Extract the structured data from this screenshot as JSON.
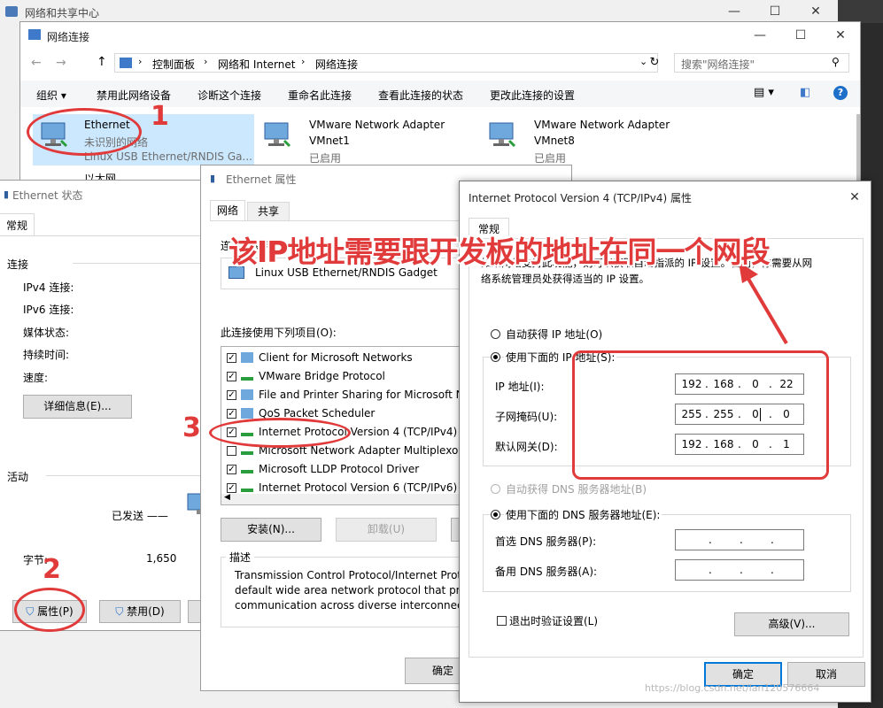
{
  "bg_window": {
    "title": "网络和共享中心"
  },
  "net_window": {
    "title": "网络连接",
    "breadcrumb": [
      "控制面板",
      "网络和 Internet",
      "网络连接"
    ],
    "search_placeholder": "搜索\"网络连接\"",
    "toolbar": [
      "组织 ▾",
      "禁用此网络设备",
      "诊断这个连接",
      "重命名此连接",
      "查看此连接的状态",
      "更改此连接的设置"
    ],
    "adapters": [
      {
        "name": "Ethernet",
        "status": "未识别的网络",
        "device": "Linux USB Ethernet/RNDIS Ga..."
      },
      {
        "name": "VMware Network Adapter",
        "status": "VMnet1",
        "device": "已启用"
      },
      {
        "name": "VMware Network Adapter",
        "status": "VMnet8",
        "device": "已启用"
      },
      {
        "name": "以太网",
        "status": "",
        "device": ""
      }
    ]
  },
  "status_window": {
    "title": "Ethernet 状态",
    "tab": "常规",
    "connection_header": "连接",
    "rows": [
      "IPv4 连接:",
      "IPv6 连接:",
      "媒体状态:",
      "持续时间:",
      "速度:"
    ],
    "details_button": "详细信息(E)...",
    "activity_header": "活动",
    "sent_label": "已发送 ——",
    "bytes_label": "字节:",
    "bytes_value": "1,650",
    "properties_button": "属性(P)",
    "disable_button": "禁用(D)"
  },
  "props_window": {
    "title": "Ethernet 属性",
    "tabs": [
      "网络",
      "共享"
    ],
    "connect_using_label": "连接时使用:",
    "adapter": "Linux USB Ethernet/RNDIS Gadget",
    "items_label": "此连接使用下列项目(O):",
    "items": [
      {
        "label": "Client for Microsoft Networks",
        "checked": true
      },
      {
        "label": "VMware Bridge Protocol",
        "checked": true
      },
      {
        "label": "File and Printer Sharing for Microsoft N",
        "checked": true
      },
      {
        "label": "QoS Packet Scheduler",
        "checked": true
      },
      {
        "label": "Internet Protocol Version 4 (TCP/IPv4)",
        "checked": true
      },
      {
        "label": "Microsoft Network Adapter Multiplexor",
        "checked": false
      },
      {
        "label": "Microsoft LLDP Protocol Driver",
        "checked": true
      },
      {
        "label": "Internet Protocol Version 6 (TCP/IPv6)",
        "checked": true
      }
    ],
    "install_button": "安装(N)...",
    "uninstall_button": "卸载(U)",
    "description_header": "描述",
    "description_lines": [
      "Transmission Control Protocol/Internet Prot",
      "default wide area network protocol that pro",
      "communication across diverse interconnecte"
    ],
    "ok_button": "确定"
  },
  "ipv4_window": {
    "title": "Internet Protocol Version 4 (TCP/IPv4) 属性",
    "tab": "常规",
    "intro_line1": "如果网络支持此功能，则可以获取自动指派的 IP 设置。否则，你需要从网",
    "intro_line2": "络系统管理员处获得适当的 IP 设置。",
    "auto_ip_label": "自动获得 IP 地址(O)",
    "manual_ip_label": "使用下面的 IP 地址(S):",
    "ip_label": "IP 地址(I):",
    "mask_label": "子网掩码(U):",
    "gateway_label": "默认网关(D):",
    "ip_address": [
      "192",
      "168",
      "0",
      "22"
    ],
    "subnet_mask": [
      "255",
      "255",
      "0",
      "0"
    ],
    "gateway": [
      "192",
      "168",
      "0",
      "1"
    ],
    "auto_dns_label": "自动获得 DNS 服务器地址(B)",
    "manual_dns_label": "使用下面的 DNS 服务器地址(E):",
    "preferred_dns_label": "首选 DNS 服务器(P):",
    "alternate_dns_label": "备用 DNS 服务器(A):",
    "validate_label": "退出时验证设置(L)",
    "advanced_button": "高级(V)...",
    "ok_button": "确定",
    "cancel_button": "取消"
  },
  "annotations": {
    "headline": "该IP地址需要跟开发板的地址在同一个网段",
    "num1": "1",
    "num2": "2",
    "num3": "3",
    "color": "#e03a3a"
  },
  "watermark": "https://blog.csdn.net/lan120576664"
}
